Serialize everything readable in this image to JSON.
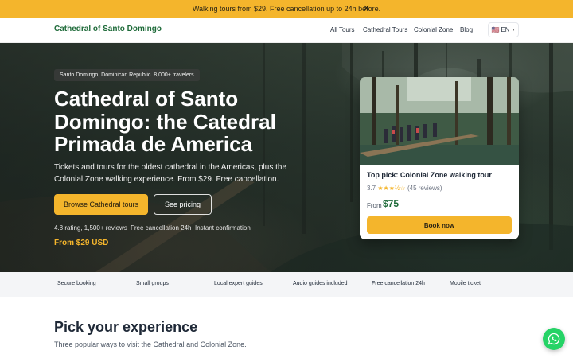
{
  "promo": {
    "text": "Walking tours from $29. Free cancellation up to 24h before.",
    "close": "✕"
  },
  "nav": {
    "logo": "Cathedral of Santo Domingo",
    "links": [
      "All Tours",
      "Cathedral Tours",
      "Colonial Zone",
      "Blog"
    ],
    "language": {
      "flag": "🇺🇸",
      "code": "EN"
    }
  },
  "hero": {
    "badge": "Santo Domingo, Dominican Republic. 8,000+ travelers",
    "title": "Cathedral of Santo Domingo: the Catedral Primada de America",
    "subtitle": "Tickets and tours for the oldest cathedral in the Americas, plus the Colonial Zone walking experience. From $29. Free cancellation.",
    "primary_button": "Browse Cathedral tours",
    "secondary_button": "See pricing",
    "stats": [
      "4.8 rating, 1,500+ reviews",
      "Free cancellation 24h",
      "Instant confirmation"
    ],
    "from_price": "From $29 USD"
  },
  "card": {
    "title": "Top pick: Colonial Zone walking tour",
    "rating_value": "3.7",
    "stars": "★★★½☆",
    "reviews": "(45 reviews)",
    "from_label": "From",
    "price": "$75",
    "button": "Book now"
  },
  "features": [
    "Secure booking",
    "Small groups",
    "Local expert guides",
    "Audio guides included",
    "Free cancellation 24h",
    "Mobile ticket"
  ],
  "section": {
    "title": "Pick your experience",
    "subtitle": "Three popular ways to visit the Cathedral and Colonial Zone."
  },
  "colors": {
    "accent": "#f4b52c",
    "brand_green": "#1f6b3a",
    "whatsapp": "#25d366"
  },
  "icons": {
    "close": "close-icon",
    "chat": "whatsapp-icon",
    "chevron": "chevron-down-icon"
  }
}
